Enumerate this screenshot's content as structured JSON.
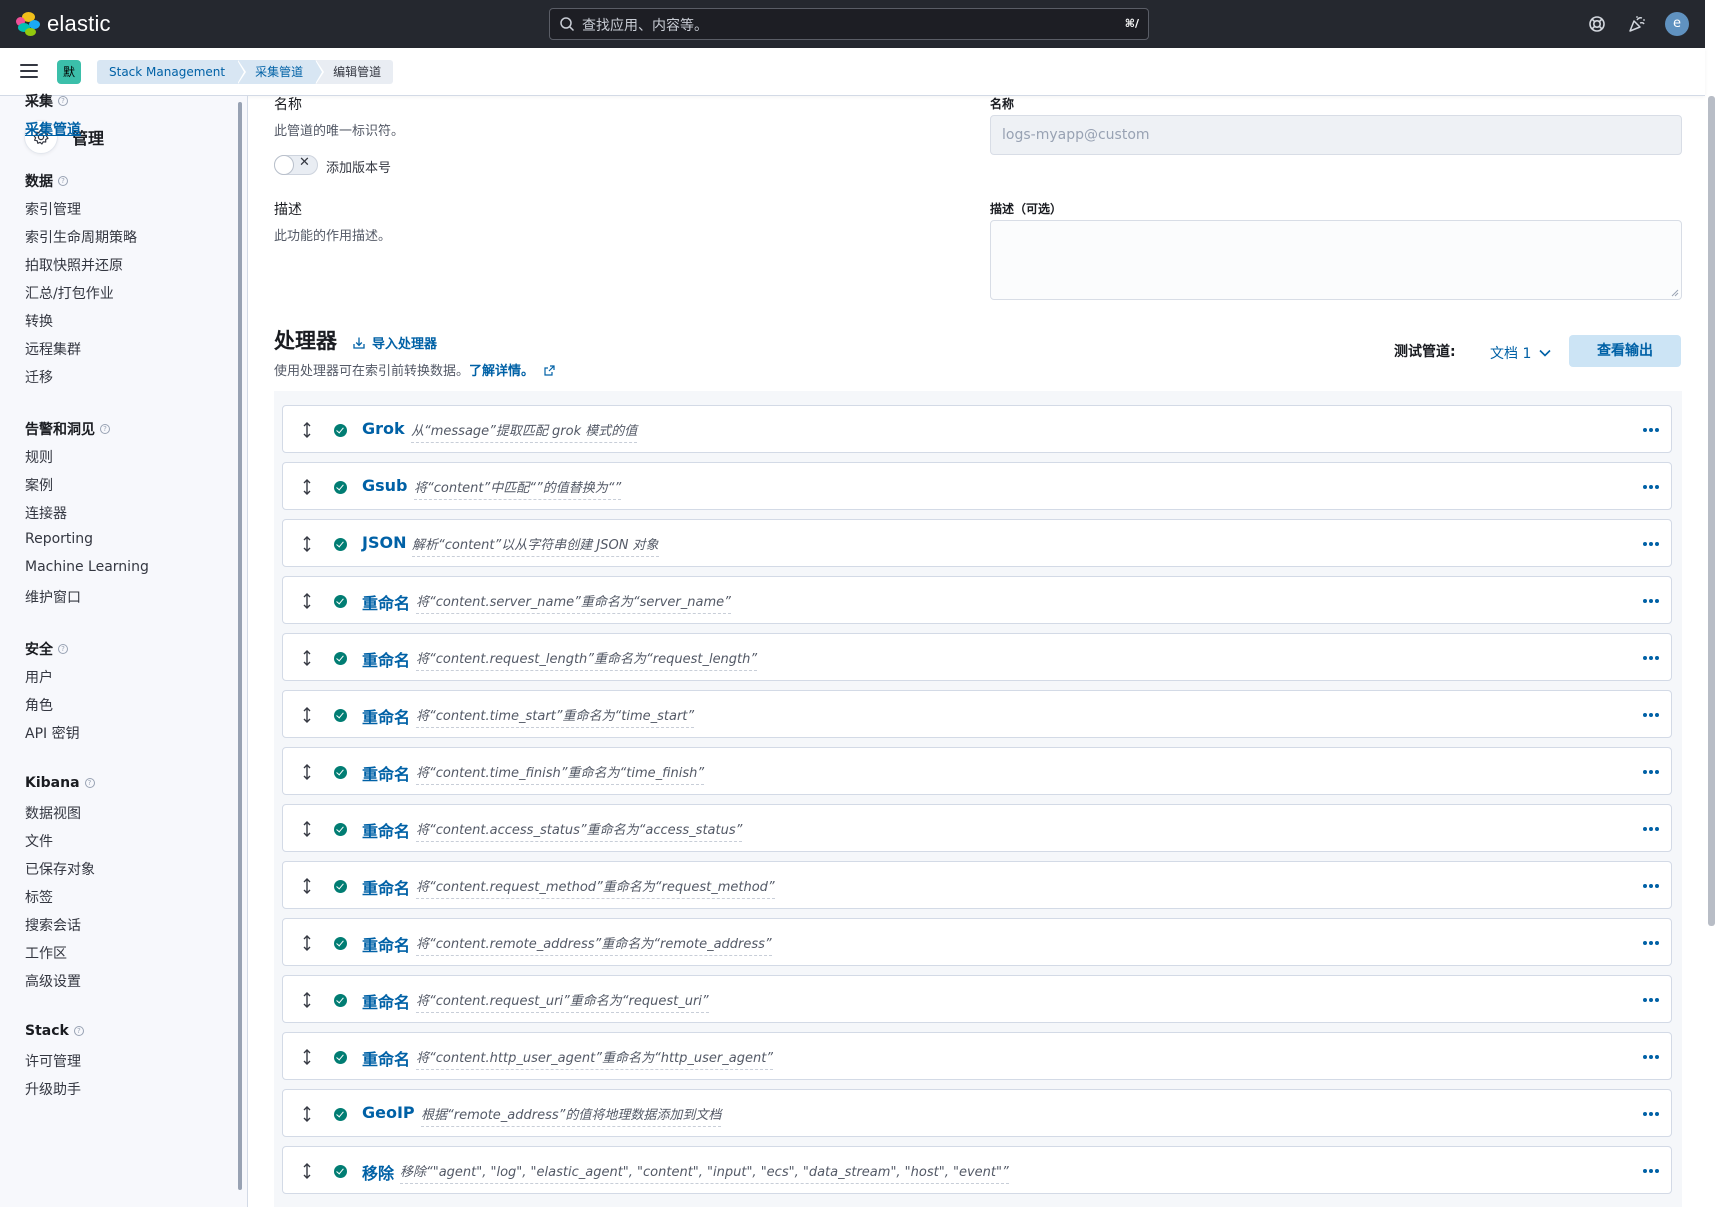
{
  "topbar": {
    "brand": "elastic",
    "search_placeholder": "查找应用、内容等。",
    "search_shortcut": "⌘/",
    "avatar_letter": "e"
  },
  "subbar": {
    "space_badge": "默",
    "breadcrumbs": [
      "Stack Management",
      "采集管道",
      "编辑管道"
    ]
  },
  "sidebar": {
    "title": "管理",
    "groups": [
      {
        "label": "采集",
        "items": [
          "采集管道"
        ]
      },
      {
        "label": "数据",
        "items": [
          "索引管理",
          "索引生命周期策略",
          "拍取快照并还原",
          "汇总/打包作业",
          "转换",
          "远程集群",
          "迁移"
        ]
      },
      {
        "label": "告警和洞见",
        "items": [
          "规则",
          "案例",
          "连接器",
          "Reporting",
          "Machine Learning",
          "维护窗口"
        ]
      },
      {
        "label": "安全",
        "items": [
          "用户",
          "角色",
          "API 密钥"
        ]
      },
      {
        "label": "Kibana",
        "items": [
          "数据视图",
          "文件",
          "已保存对象",
          "标签",
          "搜索会话",
          "工作区",
          "高级设置"
        ]
      },
      {
        "label": "Stack",
        "items": [
          "许可管理",
          "升级助手"
        ]
      }
    ]
  },
  "form": {
    "name_title": "名称",
    "name_desc": "此管道的唯一标识符。",
    "version_toggle_label": "添加版本号",
    "desc_title": "描述",
    "desc_desc": "此功能的作用描述。",
    "name_field_label": "名称",
    "name_field_value": "logs-myapp@custom",
    "desc_field_label": "描述（可选）",
    "desc_field_value": ""
  },
  "processors": {
    "title": "处理器",
    "import_label": "导入处理器",
    "description": "使用处理器可在索引前转换数据。",
    "learn_more": "了解详情。",
    "test_label": "测试管道:",
    "doc_select": "文档 1",
    "view_output": "查看输出",
    "items": [
      {
        "name": "Grok",
        "desc": "从“message”提取匹配 grok 模式的值"
      },
      {
        "name": "Gsub",
        "desc": "将“content”中匹配“”的值替换为“”"
      },
      {
        "name": "JSON",
        "desc": "解析“content”以从字符串创建 JSON 对象"
      },
      {
        "name": "重命名",
        "desc": "将“content.server_name”重命名为“server_name”"
      },
      {
        "name": "重命名",
        "desc": "将“content.request_length”重命名为“request_length”"
      },
      {
        "name": "重命名",
        "desc": "将“content.time_start”重命名为“time_start”"
      },
      {
        "name": "重命名",
        "desc": "将“content.time_finish”重命名为“time_finish”"
      },
      {
        "name": "重命名",
        "desc": "将“content.access_status”重命名为“access_status”"
      },
      {
        "name": "重命名",
        "desc": "将“content.request_method”重命名为“request_method”"
      },
      {
        "name": "重命名",
        "desc": "将“content.remote_address”重命名为“remote_address”"
      },
      {
        "name": "重命名",
        "desc": "将“content.request_uri”重命名为“request_uri”"
      },
      {
        "name": "重命名",
        "desc": "将“content.http_user_agent”重命名为“http_user_agent”"
      },
      {
        "name": "GeoIP",
        "desc": "根据“remote_address”的值将地理数据添加到文档"
      },
      {
        "name": "移除",
        "desc": "移除“\"agent\", \"log\", \"elastic_agent\", \"content\", \"input\", \"ecs\", \"data_stream\", \"host\", \"event\"”"
      }
    ]
  },
  "colors": {
    "link": "#0061a6",
    "success": "#017d73",
    "header_bg": "#25282f"
  }
}
